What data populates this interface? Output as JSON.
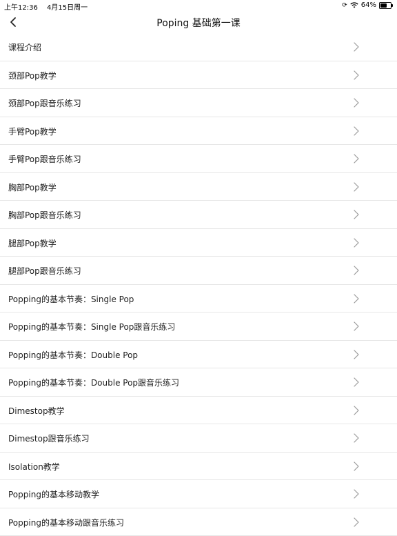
{
  "status_bar": {
    "time": "上午12:36",
    "date": "4月15日周一",
    "battery": "64%",
    "battery_level": 0.64
  },
  "nav": {
    "title": "Poping 基础第一课"
  },
  "list": {
    "items": [
      "课程介绍",
      "颈部Pop教学",
      "颈部Pop跟音乐练习",
      "手臂Pop教学",
      "手臂Pop跟音乐练习",
      "胸部Pop教学",
      "胸部Pop跟音乐练习",
      "腿部Pop教学",
      "腿部Pop跟音乐练习",
      "Popping的基本节奏：Single Pop",
      "Popping的基本节奏：Single Pop跟音乐练习",
      "Popping的基本节奏：Double Pop",
      "Popping的基本节奏：Double Pop跟音乐练习",
      "Dimestop教学",
      "Dimestop跟音乐练习",
      "Isolation教学",
      "Popping的基本移动教学",
      "Popping的基本移动跟音乐练习"
    ]
  }
}
